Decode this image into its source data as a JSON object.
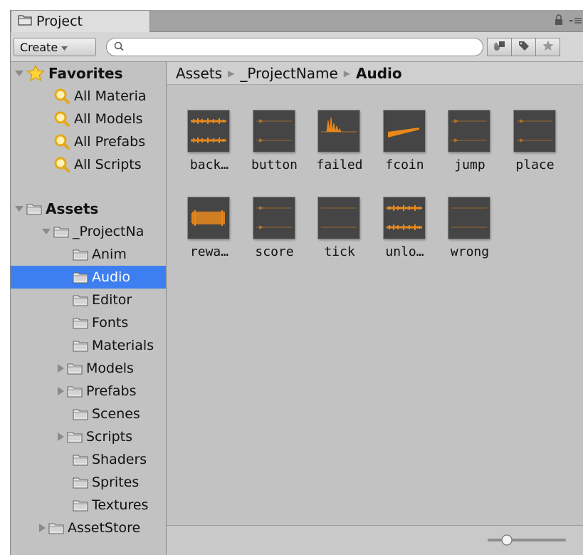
{
  "tab": {
    "title": "Project",
    "icon": "folder-icon"
  },
  "toolbar": {
    "create_label": "Create",
    "search_placeholder": "",
    "search_value": ""
  },
  "tree": {
    "favorites_label": "Favorites",
    "favorites": [
      "All Materia",
      "All Models",
      "All Prefabs",
      "All Scripts"
    ],
    "assets_label": "Assets",
    "project_label": "_ProjectNa",
    "folders": [
      {
        "label": "Anim",
        "expandable": false
      },
      {
        "label": "Audio",
        "expandable": false,
        "selected": true
      },
      {
        "label": "Editor",
        "expandable": false
      },
      {
        "label": "Fonts",
        "expandable": false
      },
      {
        "label": "Materials",
        "expandable": false
      },
      {
        "label": "Models",
        "expandable": true
      },
      {
        "label": "Prefabs",
        "expandable": true
      },
      {
        "label": "Scenes",
        "expandable": false
      },
      {
        "label": "Scripts",
        "expandable": true
      },
      {
        "label": "Shaders",
        "expandable": false
      },
      {
        "label": "Sprites",
        "expandable": false
      },
      {
        "label": "Textures",
        "expandable": false
      }
    ],
    "assetstore_label": "AssetStore"
  },
  "breadcrumb": {
    "items": [
      "Assets",
      "_ProjectName"
    ],
    "current": "Audio"
  },
  "assets": [
    {
      "name": "back…",
      "waveform": "stereo-dense"
    },
    {
      "name": "button",
      "waveform": "stereo-sparse"
    },
    {
      "name": "failed",
      "waveform": "mono-burst"
    },
    {
      "name": "fcoin",
      "waveform": "mono-decay"
    },
    {
      "name": "jump",
      "waveform": "stereo-sparse"
    },
    {
      "name": "place",
      "waveform": "stereo-sparse"
    },
    {
      "name": "rewa…",
      "waveform": "mono-dense"
    },
    {
      "name": "score",
      "waveform": "stereo-sparse"
    },
    {
      "name": "tick",
      "waveform": "stereo-flat"
    },
    {
      "name": "unlo…",
      "waveform": "stereo-dense"
    },
    {
      "name": "wrong",
      "waveform": "stereo-flat"
    }
  ],
  "colors": {
    "selection": "#3d7ff0",
    "waveform": "#e8881c",
    "thumb_bg": "#454545",
    "panel_bg": "#c2c2c2"
  }
}
